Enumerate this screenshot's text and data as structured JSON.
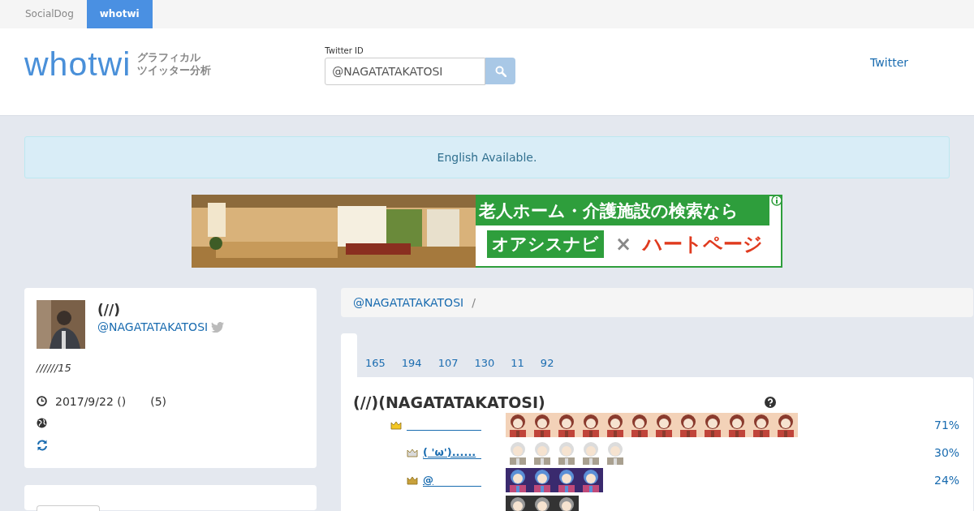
{
  "top_tabs": [
    {
      "label": "SocialDog",
      "selected": false
    },
    {
      "label": "whotwi",
      "selected": true
    }
  ],
  "header": {
    "logo": "whotwi",
    "tagline": [
      "グラフィカル",
      "ツイッター分析"
    ],
    "search": {
      "label": "Twitter ID",
      "value": "@NAGATATAKATOSI"
    },
    "nav_link": "Twitter"
  },
  "notice": "English Available.",
  "ad": {
    "headline": "老人ホーム・介護施設の検索なら",
    "brand_1": "オアシスナビ",
    "cross": "×",
    "brand_2": "ハートページ"
  },
  "profile": {
    "name": "(//)",
    "handle": "@NAGATATAKATOSI",
    "bio": "//////15",
    "joined": "2017/9/22 ()",
    "joined_note": "(5)"
  },
  "breadcrumb": {
    "items": [
      "@NAGATATAKATOSI"
    ],
    "separator": "/"
  },
  "stat_tabs": [
    {
      "label": "165",
      "selected": false
    },
    {
      "label": "194",
      "selected": false
    },
    {
      "label": "107",
      "selected": false
    },
    {
      "label": "130",
      "selected": false
    },
    {
      "label": "11",
      "selected": false
    },
    {
      "label": "92",
      "selected": false
    }
  ],
  "ranking": {
    "title": "(//)(NAGATATAKATOSI)",
    "rows": [
      {
        "kind": "gold",
        "share": "71%"
      },
      {
        "kind": "silver",
        "name": "( 'ω')......",
        "share": "30%"
      },
      {
        "kind": "bronze",
        "name": "@",
        "share": "24%"
      },
      {
        "kind": "plain"
      }
    ]
  }
}
